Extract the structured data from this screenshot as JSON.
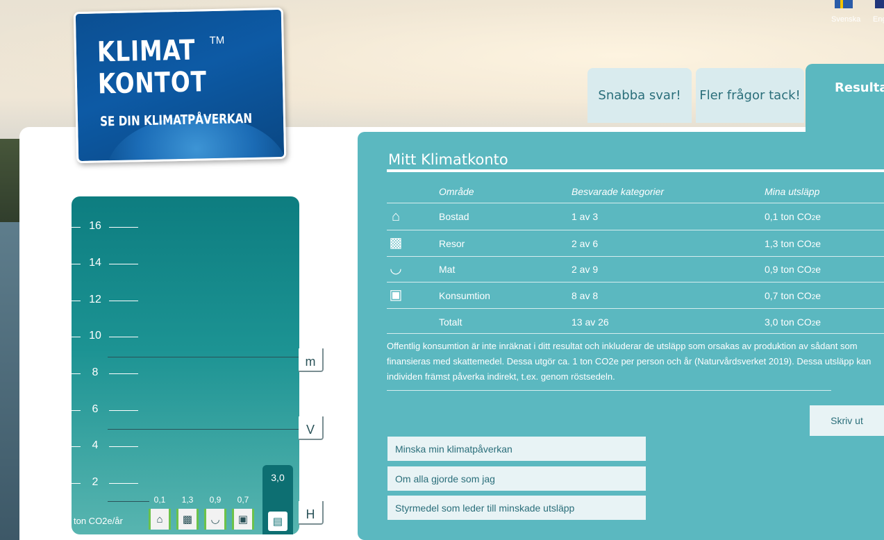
{
  "logo": {
    "line1": "KLIMAT",
    "tm": "TM",
    "line2": "KONTOT",
    "line3": "SE DIN KLIMATPÅVERKAN"
  },
  "languages": [
    {
      "label": "Svenska",
      "icon": "swedish-flag-icon"
    },
    {
      "label": "Eng",
      "icon": "english-flag-icon"
    }
  ],
  "tabs": [
    {
      "label": "Snabba svar!"
    },
    {
      "label": "Fler frågor tack!"
    },
    {
      "label": "Resultat",
      "active": true
    }
  ],
  "result": {
    "title": "Mitt Klimatkonto",
    "headers": {
      "area": "Område",
      "answered": "Besvarade kategorier",
      "emissions": "Mina utsläpp"
    },
    "rows": [
      {
        "icon": "house-icon",
        "area": "Bostad",
        "answered": "1 av 3",
        "emission_value": "0,1 ton CO",
        "sub": "2",
        "suffix": "e"
      },
      {
        "icon": "suitcase-icon",
        "area": "Resor",
        "answered": "2 av 6",
        "emission_value": "1,3 ton CO",
        "sub": "2",
        "suffix": "e"
      },
      {
        "icon": "food-bowl-icon",
        "area": "Mat",
        "answered": "2 av 9",
        "emission_value": "0,9 ton CO",
        "sub": "2",
        "suffix": "e"
      },
      {
        "icon": "screen-icon",
        "area": "Konsumtion",
        "answered": "8 av 8",
        "emission_value": "0,7 ton CO",
        "sub": "2",
        "suffix": "e"
      },
      {
        "icon": "",
        "area": "Totalt",
        "answered": "13 av 26",
        "emission_value": "3,0 ton CO",
        "sub": "2",
        "suffix": "e"
      }
    ],
    "note": "Offentlig konsumtion är inte inräknat i ditt resultat och inkluderar de utsläpp som orsakas av produktion av sådant som finansieras med skattemedel. Dessa utgör ca. 1 ton CO2e per person och år (Naturvårdsverket 2019). Dessa utsläpp kan individen främst påverka indirekt, t.ex. genom röstsedeln.",
    "print_label": "Skriv ut",
    "links": [
      "Minska min klimatpåverkan",
      "Om alla gjorde som jag",
      "Styrmedel som leder till minskade utsläpp"
    ]
  },
  "gauge": {
    "ticks": [
      "16",
      "14",
      "12",
      "10",
      "8",
      "6",
      "4",
      "2"
    ],
    "unit": "ton CO2e/år",
    "markers": [
      {
        "label": "m",
        "value": 8.9
      },
      {
        "label": "V",
        "value": 4.9
      },
      {
        "label": "H",
        "value": 1.0
      }
    ],
    "bars": [
      {
        "value": "0,1",
        "icon": "house-icon"
      },
      {
        "value": "1,3",
        "icon": "suitcase-icon"
      },
      {
        "value": "0,9",
        "icon": "food-bowl-icon"
      },
      {
        "value": "0,7",
        "icon": "screen-icon"
      }
    ],
    "total": {
      "value": "3,0",
      "icon": "document-icon"
    }
  },
  "colors": {
    "panel": "#5bb8c0",
    "gauge_top": "#0d7d80",
    "tab_inactive": "#d9ebee",
    "logo_blue": "#0b4f92",
    "bar_accent": "#6cc24a"
  }
}
